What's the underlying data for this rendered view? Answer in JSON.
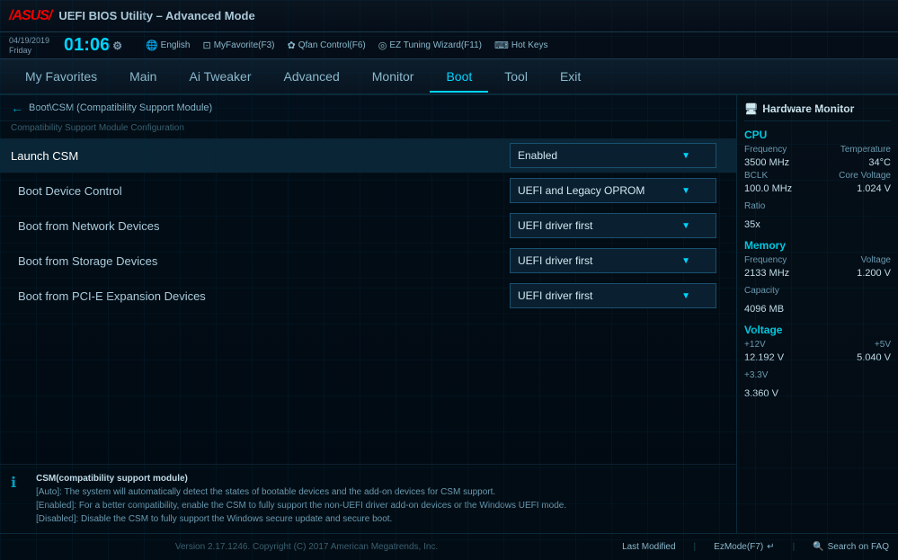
{
  "header": {
    "logo": "/asus/",
    "title": "UEFI BIOS Utility – Advanced Mode",
    "date": "04/19/2019",
    "day": "Friday",
    "time": "01:06",
    "language": "English",
    "tools": [
      {
        "label": "MyFavorite(F3)",
        "icon": "⊡"
      },
      {
        "label": "Qfan Control(F6)",
        "icon": "✿"
      },
      {
        "label": "EZ Tuning Wizard(F11)",
        "icon": "◎"
      },
      {
        "label": "Hot Keys",
        "icon": "⌨"
      }
    ]
  },
  "nav": {
    "tabs": [
      {
        "label": "My Favorites",
        "active": false
      },
      {
        "label": "Main",
        "active": false
      },
      {
        "label": "Ai Tweaker",
        "active": false
      },
      {
        "label": "Advanced",
        "active": false
      },
      {
        "label": "Monitor",
        "active": false
      },
      {
        "label": "Boot",
        "active": true
      },
      {
        "label": "Tool",
        "active": false
      },
      {
        "label": "Exit",
        "active": false
      }
    ]
  },
  "breadcrumb": {
    "path": "Boot\\CSM (Compatibility Support Module)",
    "subtitle": "Compatibility Support Module Configuration"
  },
  "settings": [
    {
      "label": "Launch CSM",
      "value": "Enabled",
      "highlighted": true,
      "dropdown": true
    },
    {
      "label": "Boot Device Control",
      "value": "UEFI and Legacy OPROM",
      "highlighted": false,
      "dropdown": true
    },
    {
      "label": "Boot from Network Devices",
      "value": "UEFI driver first",
      "highlighted": false,
      "dropdown": true
    },
    {
      "label": "Boot from Storage Devices",
      "value": "UEFI driver first",
      "highlighted": false,
      "dropdown": true
    },
    {
      "label": "Boot from PCI-E Expansion Devices",
      "value": "UEFI driver first",
      "highlighted": false,
      "dropdown": true
    }
  ],
  "info": {
    "title": "CSM(compatibility support module)",
    "lines": [
      "[Auto]: The system will automatically detect the states of bootable devices and the add-on devices for CSM support.",
      "[Enabled]: For a better compatibility, enable the CSM to fully support the non-UEFI driver add-on devices or the Windows UEFI mode.",
      "[Disabled]: Disable the CSM to fully support the Windows secure update and secure boot."
    ]
  },
  "hw_monitor": {
    "title": "Hardware Monitor",
    "cpu": {
      "section": "CPU",
      "frequency_label": "Frequency",
      "frequency_value": "3500 MHz",
      "temperature_label": "Temperature",
      "temperature_value": "34°C",
      "bclk_label": "BCLK",
      "bclk_value": "100.0 MHz",
      "core_voltage_label": "Core Voltage",
      "core_voltage_value": "1.024 V",
      "ratio_label": "Ratio",
      "ratio_value": "35x"
    },
    "memory": {
      "section": "Memory",
      "frequency_label": "Frequency",
      "frequency_value": "2133 MHz",
      "voltage_label": "Voltage",
      "voltage_value": "1.200 V",
      "capacity_label": "Capacity",
      "capacity_value": "4096 MB"
    },
    "voltage": {
      "section": "Voltage",
      "v12_label": "+12V",
      "v12_value": "12.192 V",
      "v5_label": "+5V",
      "v5_value": "5.040 V",
      "v33_label": "+3.3V",
      "v33_value": "3.360 V"
    }
  },
  "footer": {
    "last_modified": "Last Modified",
    "ez_mode": "EzMode(F7)",
    "search": "Search on FAQ",
    "version": "Version 2.17.1246. Copyright (C) 2017 American Megatrends, Inc."
  }
}
